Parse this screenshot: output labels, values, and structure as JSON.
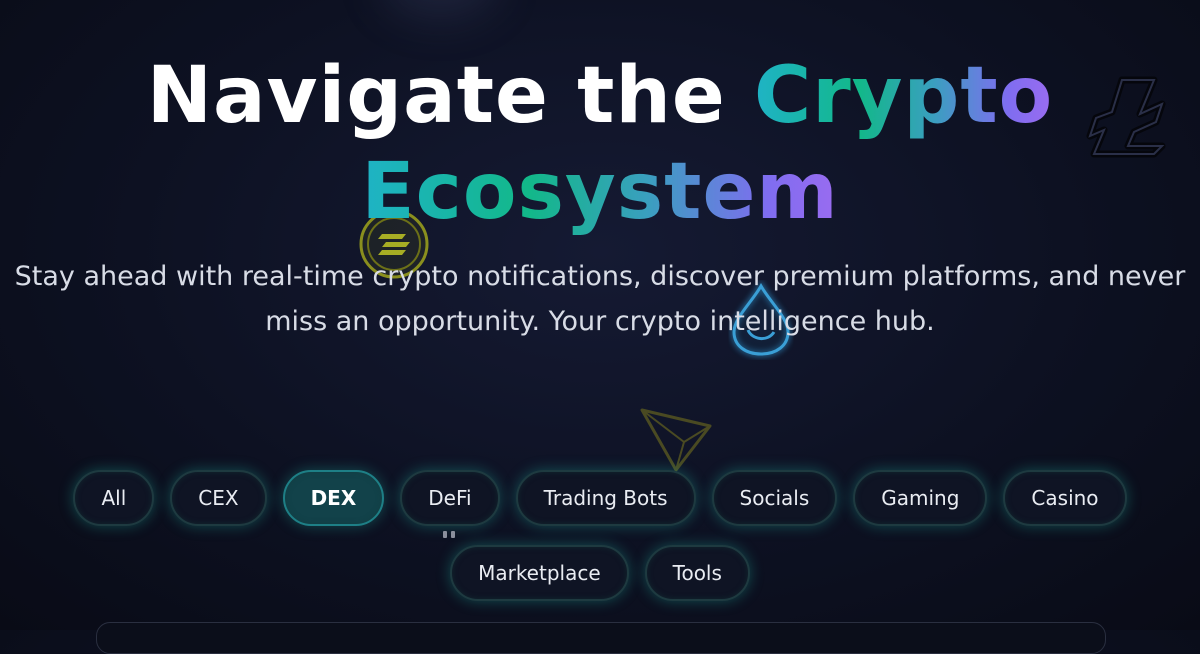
{
  "hero": {
    "title_line1_plain": "Navigate the ",
    "title_line1_accent": "Crypto",
    "title_line2_accent": "Ecosystem",
    "subtitle_line1": "Stay ahead with real-time crypto notifications, discover premium platforms, and never",
    "subtitle_line2": "miss an opportunity. Your crypto intelligence hub."
  },
  "filters": {
    "row1": [
      "All",
      "CEX",
      "DEX",
      "DeFi",
      "Trading Bots",
      "Socials",
      "Gaming",
      "Casino"
    ],
    "row2": [
      "Marketplace",
      "Tools"
    ],
    "active": "DEX"
  },
  "decor_icons": [
    "solana-coin-icon",
    "sui-drop-icon",
    "tron-icon",
    "litecoin-icon"
  ],
  "colors": {
    "background": "#0d1122",
    "accent_teal": "#12b889",
    "accent_cyan": "#1fb3c6",
    "accent_purple": "#9a6cf0",
    "chip_active_bg": "#12424a"
  }
}
